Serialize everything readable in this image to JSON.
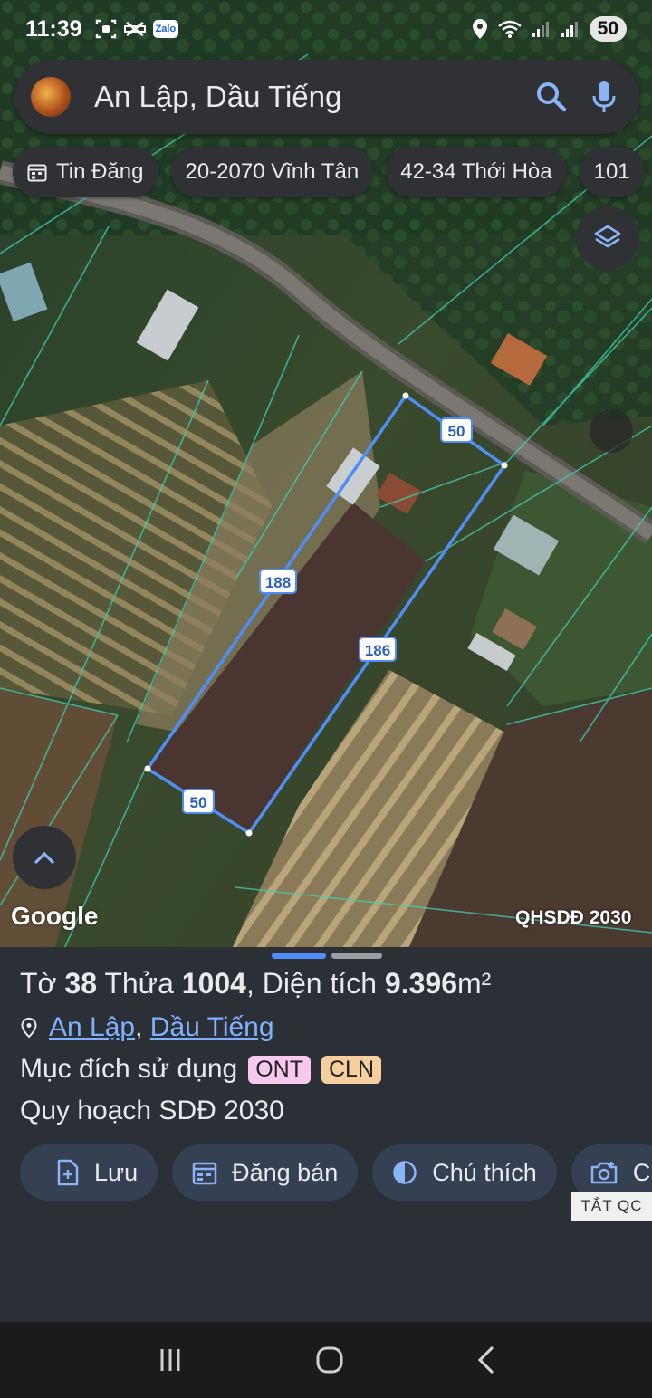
{
  "status_bar": {
    "time": "11:39",
    "battery": "50",
    "zalo_label": "Zalo"
  },
  "search": {
    "query": "An Lập, Dầu Tiếng"
  },
  "chips": [
    {
      "label": "Tin Đăng",
      "icon": "calendar-icon"
    },
    {
      "label": "20-2070 Vĩnh Tân"
    },
    {
      "label": "42-34 Thới Hòa"
    },
    {
      "label": "101"
    }
  ],
  "map": {
    "plot_edges": {
      "top": "50",
      "left": "188",
      "right": "186",
      "bottom": "50"
    },
    "google_logo": "Google",
    "overlay_label": "QHSDĐ 2030",
    "outline_color": "#4f8ef7"
  },
  "parcel": {
    "sheet_label": "Tờ",
    "sheet_no": "38",
    "parcel_label": "Thửa",
    "parcel_no": "1004",
    "area_label": ", Diện tích",
    "area": "9.396",
    "area_unit": "m²",
    "ward": "An Lập",
    "district": "Dầu Tiếng",
    "separator": ",",
    "purpose_label": "Mục đích sử dụng",
    "purpose_tags": [
      "ONT",
      "CLN"
    ],
    "plan": "Quy hoạch SDĐ 2030"
  },
  "actions": [
    {
      "label": "Lưu",
      "icon": "save-icon"
    },
    {
      "label": "Đăng bán",
      "icon": "calendar-icon"
    },
    {
      "label": "Chú thích",
      "icon": "legend-icon"
    },
    {
      "label": "C",
      "icon": "camera-icon"
    }
  ],
  "ad_tag": "TẮT QC"
}
